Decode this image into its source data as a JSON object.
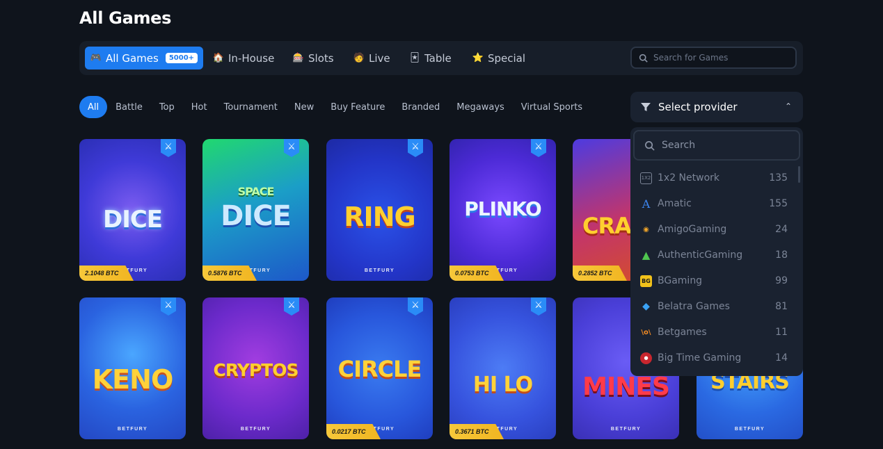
{
  "page_title": "All Games",
  "categories": [
    {
      "label": "All Games",
      "badge": "5000+",
      "icon": "gamepad-icon"
    },
    {
      "label": "In-House",
      "icon": "house-icon"
    },
    {
      "label": "Slots",
      "icon": "slots-icon"
    },
    {
      "label": "Live",
      "icon": "live-dealer-icon"
    },
    {
      "label": "Table",
      "icon": "cards-icon"
    },
    {
      "label": "Special",
      "icon": "star-icon"
    }
  ],
  "search": {
    "placeholder": "Search for Games"
  },
  "filters": [
    "All",
    "Battle",
    "Top",
    "Hot",
    "Tournament",
    "New",
    "Buy Feature",
    "Branded",
    "Megaways",
    "Virtual Sports"
  ],
  "provider_select": {
    "label": "Select provider"
  },
  "dropdown": {
    "search_placeholder": "Search",
    "providers": [
      {
        "name": "1x2 Network",
        "count": "135"
      },
      {
        "name": "Amatic",
        "count": "155"
      },
      {
        "name": "AmigoGaming",
        "count": "24"
      },
      {
        "name": "AuthenticGaming",
        "count": "18"
      },
      {
        "name": "BGaming",
        "count": "99"
      },
      {
        "name": "Belatra Games",
        "count": "81"
      },
      {
        "name": "Betgames",
        "count": "11"
      },
      {
        "name": "Big Time Gaming",
        "count": "14"
      }
    ]
  },
  "brand": "BETFURY",
  "games": [
    {
      "title": "DICE",
      "price": "2.1048 BTC"
    },
    {
      "title": "DICE",
      "subtitle": "SPACE",
      "price": "0.5876 BTC"
    },
    {
      "title": "RING",
      "price": ""
    },
    {
      "title": "PLINKO",
      "price": "0.0753 BTC"
    },
    {
      "title": "CRA",
      "price": "0.2852 BTC"
    },
    {
      "title": "KENO",
      "price": ""
    },
    {
      "title": "CRYPTOS",
      "price": ""
    },
    {
      "title": "CIRCLE",
      "price": "0.0217 BTC"
    },
    {
      "title": "HI LO",
      "price": "0.3671 BTC"
    },
    {
      "title": "MINES",
      "price": ""
    },
    {
      "title": "STAIRS",
      "price": ""
    }
  ],
  "colors": {
    "accent": "#1e7cf0",
    "background": "#0f141c",
    "panel": "#1a2230",
    "price_tag": "#f7c83a"
  }
}
